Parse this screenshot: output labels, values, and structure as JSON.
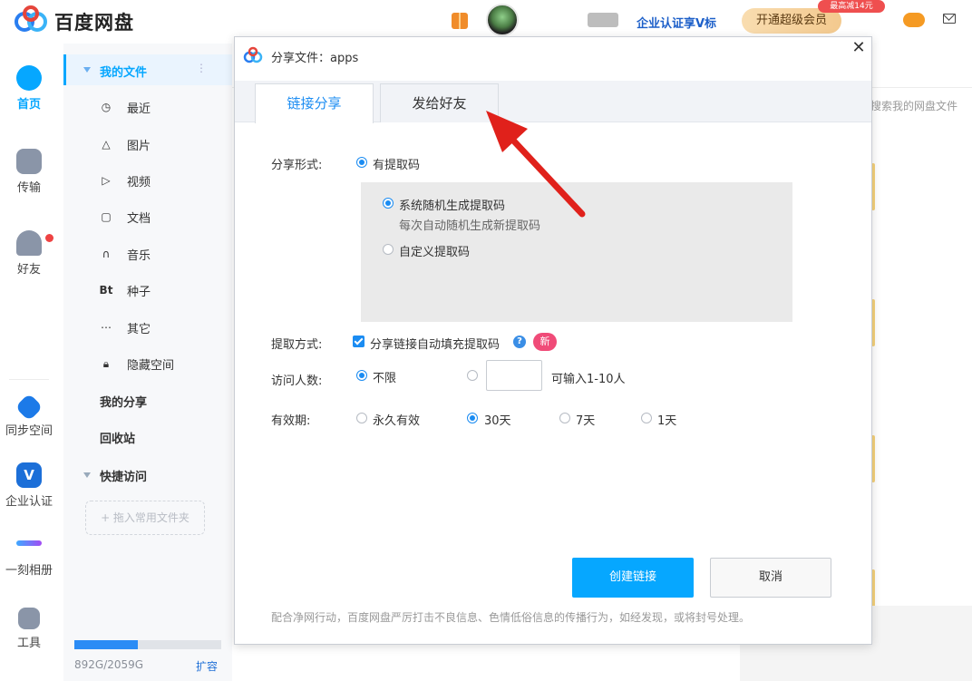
{
  "app": {
    "name": "百度网盘"
  },
  "topbar": {
    "enterprise_link": "企业认证享V标",
    "open_vip": "开通超级会员",
    "promo_badge": "最高减14元"
  },
  "rail": {
    "items": [
      {
        "label": "首页",
        "icon": "cloud-home-icon"
      },
      {
        "label": "传输",
        "icon": "transfer-icon"
      },
      {
        "label": "好友",
        "icon": "friends-icon"
      },
      {
        "label": "同步空间",
        "icon": "sync-space-icon"
      },
      {
        "label": "企业认证",
        "icon": "enterprise-v-icon"
      },
      {
        "label": "一刻相册",
        "icon": "album-icon"
      },
      {
        "label": "工具",
        "icon": "tools-icon"
      }
    ]
  },
  "sidebar": {
    "my_files": "我的文件",
    "items": [
      {
        "label": "最近",
        "icon": "clock-icon"
      },
      {
        "label": "图片",
        "icon": "image-icon"
      },
      {
        "label": "视频",
        "icon": "play-icon"
      },
      {
        "label": "文档",
        "icon": "document-icon"
      },
      {
        "label": "音乐",
        "icon": "headphone-icon"
      },
      {
        "label": "种子",
        "icon": "bt-icon",
        "glyph": "Bt"
      },
      {
        "label": "其它",
        "icon": "more-icon"
      },
      {
        "label": "隐藏空间",
        "icon": "lock-icon"
      }
    ],
    "my_share": "我的分享",
    "recycle": "回收站",
    "quick_access": "快捷访问",
    "drop_hint": "+ 拖入常用文件夹",
    "storage": {
      "text": "892G/2059G",
      "used_fraction": 0.433
    },
    "expand": "扩容"
  },
  "main": {
    "search_placeholder": "搜索我的网盘文件"
  },
  "dialog": {
    "title": "分享文件：apps",
    "tabs": [
      {
        "label": "链接分享",
        "active": true
      },
      {
        "label": "发给好友",
        "active": false
      }
    ],
    "share_form": {
      "label": "分享形式:",
      "option": "有提取码",
      "sub_options": [
        {
          "label": "系统随机生成提取码",
          "desc": "每次自动随机生成新提取码",
          "selected": true
        },
        {
          "label": "自定义提取码",
          "selected": false
        }
      ]
    },
    "extract_method": {
      "label": "提取方式:",
      "checkbox_label": "分享链接自动填充提取码",
      "checked": true,
      "new_badge": "新"
    },
    "visitors": {
      "label": "访问人数:",
      "unlimited": "不限",
      "input_hint": "可输入1-10人",
      "value": ""
    },
    "validity": {
      "label": "有效期:",
      "options": [
        {
          "label": "永久有效",
          "selected": false
        },
        {
          "label": "30天",
          "selected": true
        },
        {
          "label": "7天",
          "selected": false
        },
        {
          "label": "1天",
          "selected": false
        }
      ]
    },
    "create_button": "创建链接",
    "cancel_button": "取消",
    "notice": "配合净网行动，百度网盘严厉打击不良信息、色情低俗信息的传播行为，如经发现，或将封号处理。"
  },
  "colors": {
    "accent": "#06a7ff",
    "arrow": "#e0211b",
    "link": "#1c5fc9"
  }
}
